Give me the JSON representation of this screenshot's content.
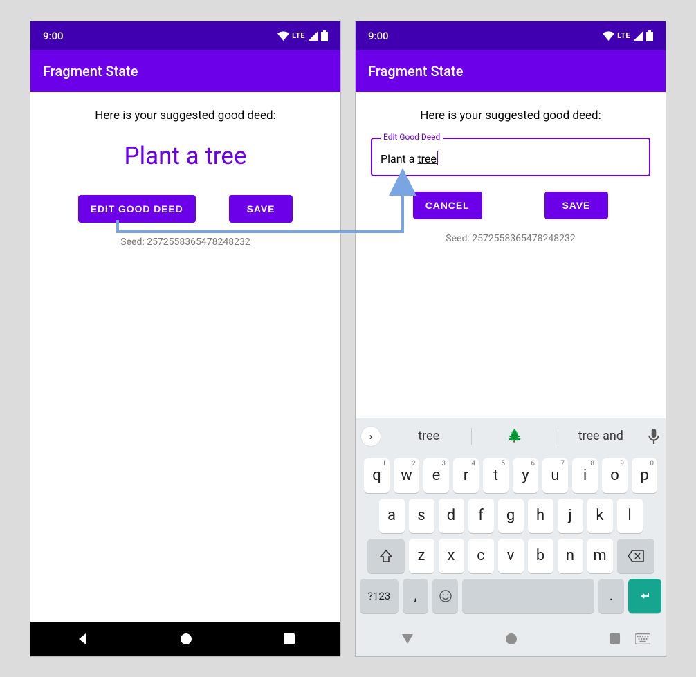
{
  "status": {
    "time": "9:00",
    "network": "LTE"
  },
  "app": {
    "title": "Fragment State"
  },
  "left": {
    "suggested_label": "Here is your suggested good deed:",
    "deed": "Plant a tree",
    "buttons": {
      "edit": "EDIT GOOD DEED",
      "save": "SAVE"
    },
    "seed": "Seed: 2572558365478248232"
  },
  "right": {
    "suggested_label": "Here is your suggested good deed:",
    "field_label": "Edit Good Deed",
    "field_value_prefix": "Plant a ",
    "field_value_underlined": "tree",
    "buttons": {
      "cancel": "CANCEL",
      "save": "SAVE"
    },
    "seed": "Seed: 2572558365478248232"
  },
  "keyboard": {
    "suggestions": [
      "tree",
      "🌲",
      "tree and"
    ],
    "row1": [
      {
        "k": "q",
        "n": "1"
      },
      {
        "k": "w",
        "n": "2"
      },
      {
        "k": "e",
        "n": "3"
      },
      {
        "k": "r",
        "n": "4"
      },
      {
        "k": "t",
        "n": "5"
      },
      {
        "k": "y",
        "n": "6"
      },
      {
        "k": "u",
        "n": "7"
      },
      {
        "k": "i",
        "n": "8"
      },
      {
        "k": "o",
        "n": "9"
      },
      {
        "k": "p",
        "n": "0"
      }
    ],
    "row2": [
      "a",
      "s",
      "d",
      "f",
      "g",
      "h",
      "j",
      "k",
      "l"
    ],
    "row3": [
      "z",
      "x",
      "c",
      "v",
      "b",
      "n",
      "m"
    ],
    "symbols_label": "?123",
    "comma": ",",
    "period": "."
  }
}
